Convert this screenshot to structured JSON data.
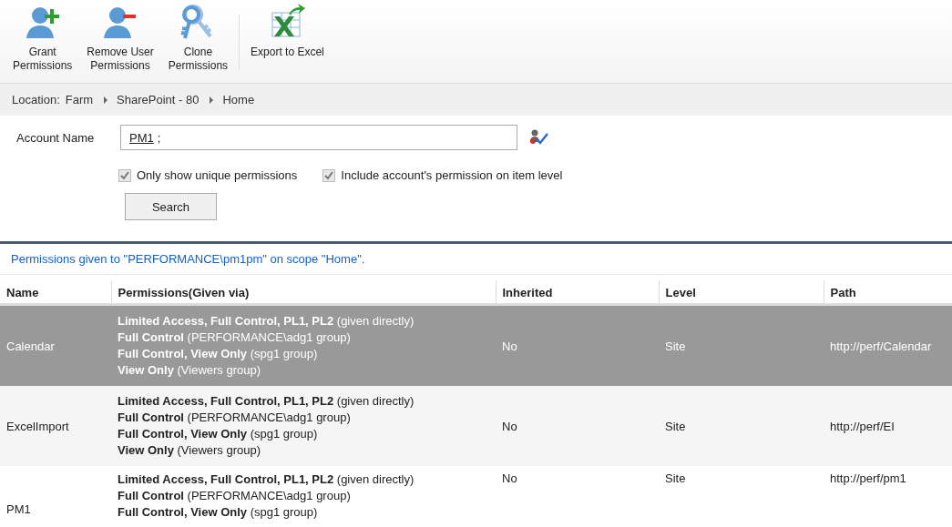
{
  "toolbar": {
    "groups": [
      [
        {
          "kind": "grant",
          "label": [
            "Grant",
            "Permissions"
          ]
        },
        {
          "kind": "remove",
          "label": [
            "Remove User",
            "Permissions"
          ]
        },
        {
          "kind": "clone",
          "label": [
            "Clone",
            "Permissions"
          ]
        }
      ],
      [
        {
          "kind": "export",
          "label": [
            "Export to Excel"
          ]
        }
      ]
    ]
  },
  "breadcrumb": {
    "label": "Location:",
    "items": [
      "Farm",
      "SharePoint - 80",
      "Home"
    ]
  },
  "form": {
    "account_label": "Account Name",
    "account_entries": [
      "PM1"
    ],
    "account_trailing": ";",
    "options": [
      {
        "label": "Only show unique permissions",
        "checked": true
      },
      {
        "label": "Include account's permission on item level",
        "checked": true
      }
    ],
    "search_button": "Search"
  },
  "message": "Permissions given to \"PERFORMANCE\\pm1pm\" on scope \"Home\".",
  "table": {
    "columns": [
      "Name",
      "Permissions(Given via)",
      "Inherited",
      "Level",
      "Path"
    ],
    "rows": [
      {
        "selected": true,
        "name": "Calendar",
        "permissions": [
          "**Limited Access, Full Control, PL1, PL2** (given directly)",
          "**Full Control** (PERFORMANCE\\adg1 group)",
          "**Full Control, View Only** (spg1 group)",
          "**View Only** (Viewers group)"
        ],
        "inherited": "No",
        "level": "Site",
        "path": "http://perf/Calendar"
      },
      {
        "selected": false,
        "name": "ExcelImport",
        "permissions": [
          "**Limited Access, Full Control, PL1, PL2** (given directly)",
          "**Full Control** (PERFORMANCE\\adg1 group)",
          "**Full Control, View Only** (spg1 group)",
          "**View Only** (Viewers group)"
        ],
        "inherited": "No",
        "level": "Site",
        "path": "http://perf/EI"
      },
      {
        "selected": false,
        "name": "PM1",
        "permissions": [
          "**Limited Access, Full Control, PL1, PL2** (given directly)",
          "**Full Control** (PERFORMANCE\\adg1 group)",
          "**Full Control, View Only** (spg1 group)"
        ],
        "inherited": "No",
        "level": "Site",
        "path": "http://perf/pm1"
      }
    ]
  }
}
